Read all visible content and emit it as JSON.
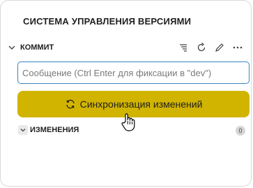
{
  "panel": {
    "title": "СИСТЕМА УПРАВЛЕНИЯ ВЕРСИЯМИ"
  },
  "commit_section": {
    "label": "КОММИТ",
    "actions": [
      "tree-view-icon",
      "refresh-icon",
      "pencil-icon",
      "more-icon"
    ]
  },
  "message_input": {
    "value": "",
    "placeholder": "Сообщение (Ctrl Enter для фиксации в \"dev\")"
  },
  "sync_button": {
    "icon": "sync-icon",
    "label": "Синхронизация изменений"
  },
  "changes_section": {
    "label": "ИЗМЕНЕНИЯ",
    "count": "0"
  },
  "colors": {
    "accent": "#d1b400",
    "input_border": "#3b82c4"
  }
}
